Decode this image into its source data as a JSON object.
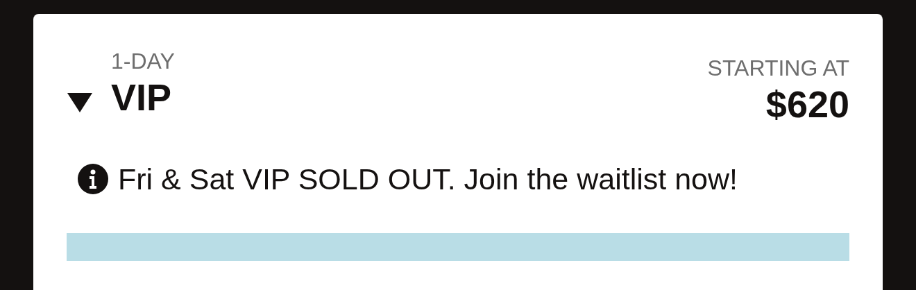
{
  "ticket": {
    "expanded": true,
    "duration": "1-DAY",
    "name": "VIP",
    "price_label": "STARTING AT",
    "price": "$620"
  },
  "notice": {
    "text": "Fri & Sat VIP SOLD OUT. Join the waitlist now!"
  }
}
